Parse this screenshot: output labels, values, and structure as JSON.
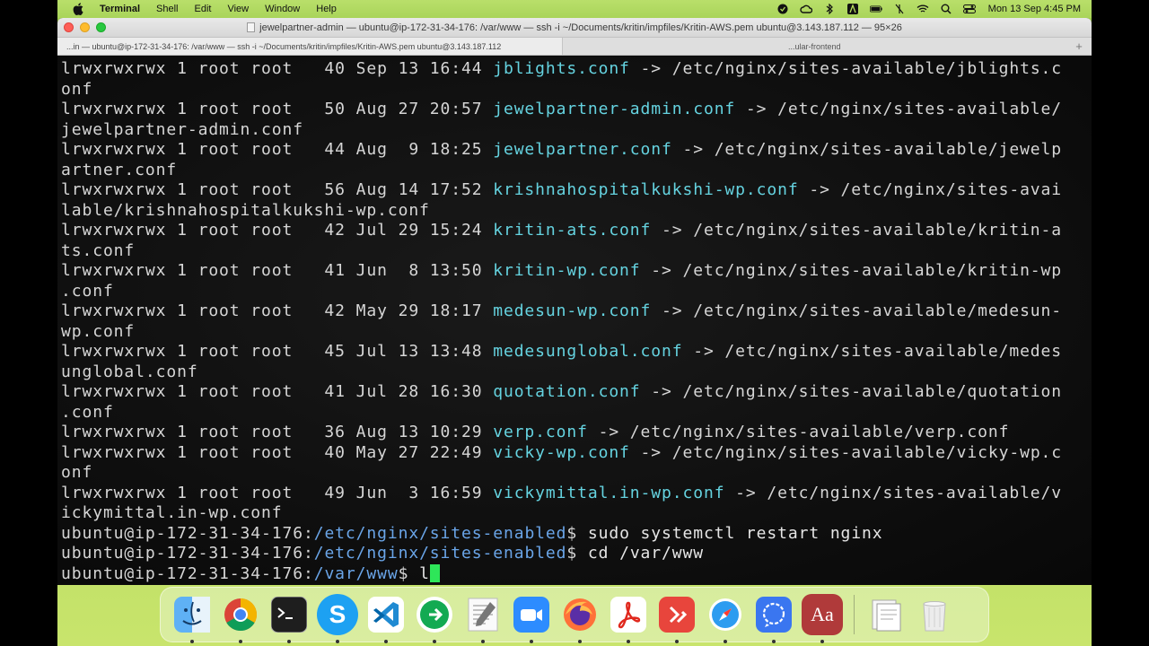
{
  "menubar": {
    "app_name": "Terminal",
    "items": [
      "Shell",
      "Edit",
      "View",
      "Window",
      "Help"
    ],
    "clock": "Mon 13 Sep  4:45 PM",
    "status_icons": [
      "vpn-icon",
      "creative-cloud-icon",
      "bluetooth-icon",
      "adobe-icon",
      "battery-icon",
      "extra-icon",
      "wifi-icon",
      "spotlight-search-icon",
      "control-center-icon"
    ]
  },
  "window": {
    "title": "jewelpartner-admin — ubuntu@ip-172-31-34-176: /var/www — ssh -i ~/Documents/kritin/impfiles/Kritin-AWS.pem ubuntu@3.143.187.112 — 95×26",
    "tabs": [
      {
        "label": "...in — ubuntu@ip-172-31-34-176: /var/www — ssh -i ~/Documents/kritin/impfiles/Kritin-AWS.pem ubuntu@3.143.187.112"
      },
      {
        "label": "...ular-frontend"
      }
    ],
    "add_tab": "+"
  },
  "terminal": {
    "lines": [
      {
        "type": "entry",
        "perm": "lrwxrwxrwx 1 root root   40 Sep 13 16:44 ",
        "link": "jblights.conf",
        "rest": " -> /etc/nginx/sites-available/jblights.c"
      },
      {
        "type": "plain",
        "text": "onf"
      },
      {
        "type": "entry",
        "perm": "lrwxrwxrwx 1 root root   50 Aug 27 20:57 ",
        "link": "jewelpartner-admin.conf",
        "rest": " -> /etc/nginx/sites-available/"
      },
      {
        "type": "plain",
        "text": "jewelpartner-admin.conf"
      },
      {
        "type": "entry",
        "perm": "lrwxrwxrwx 1 root root   44 Aug  9 18:25 ",
        "link": "jewelpartner.conf",
        "rest": " -> /etc/nginx/sites-available/jewelp"
      },
      {
        "type": "plain",
        "text": "artner.conf"
      },
      {
        "type": "entry",
        "perm": "lrwxrwxrwx 1 root root   56 Aug 14 17:52 ",
        "link": "krishnahospitalkukshi-wp.conf",
        "rest": " -> /etc/nginx/sites-avai"
      },
      {
        "type": "plain",
        "text": "lable/krishnahospitalkukshi-wp.conf"
      },
      {
        "type": "entry",
        "perm": "lrwxrwxrwx 1 root root   42 Jul 29 15:24 ",
        "link": "kritin-ats.conf",
        "rest": " -> /etc/nginx/sites-available/kritin-a"
      },
      {
        "type": "plain",
        "text": "ts.conf"
      },
      {
        "type": "entry",
        "perm": "lrwxrwxrwx 1 root root   41 Jun  8 13:50 ",
        "link": "kritin-wp.conf",
        "rest": " -> /etc/nginx/sites-available/kritin-wp"
      },
      {
        "type": "plain",
        "text": ".conf"
      },
      {
        "type": "entry",
        "perm": "lrwxrwxrwx 1 root root   42 May 29 18:17 ",
        "link": "medesun-wp.conf",
        "rest": " -> /etc/nginx/sites-available/medesun-"
      },
      {
        "type": "plain",
        "text": "wp.conf"
      },
      {
        "type": "entry",
        "perm": "lrwxrwxrwx 1 root root   45 Jul 13 13:48 ",
        "link": "medesunglobal.conf",
        "rest": " -> /etc/nginx/sites-available/medes"
      },
      {
        "type": "plain",
        "text": "unglobal.conf"
      },
      {
        "type": "entry",
        "perm": "lrwxrwxrwx 1 root root   41 Jul 28 16:30 ",
        "link": "quotation.conf",
        "rest": " -> /etc/nginx/sites-available/quotation"
      },
      {
        "type": "plain",
        "text": ".conf"
      },
      {
        "type": "entry",
        "perm": "lrwxrwxrwx 1 root root   36 Aug 13 10:29 ",
        "link": "verp.conf",
        "rest": " -> /etc/nginx/sites-available/verp.conf"
      },
      {
        "type": "entry",
        "perm": "lrwxrwxrwx 1 root root   40 May 27 22:49 ",
        "link": "vicky-wp.conf",
        "rest": " -> /etc/nginx/sites-available/vicky-wp.c"
      },
      {
        "type": "plain",
        "text": "onf"
      },
      {
        "type": "entry",
        "perm": "lrwxrwxrwx 1 root root   49 Jun  3 16:59 ",
        "link": "vickymittal.in-wp.conf",
        "rest": " -> /etc/nginx/sites-available/v"
      },
      {
        "type": "plain",
        "text": "ickymittal.in-wp.conf"
      },
      {
        "type": "prompt",
        "user": "ubuntu@ip-172-31-34-176",
        "sep": ":",
        "path": "/etc/nginx/sites-enabled",
        "sym": "$ ",
        "cmd": "sudo systemctl restart nginx"
      },
      {
        "type": "prompt",
        "user": "ubuntu@ip-172-31-34-176",
        "sep": ":",
        "path": "/etc/nginx/sites-enabled",
        "sym": "$ ",
        "cmd": "cd /var/www"
      },
      {
        "type": "prompt",
        "user": "ubuntu@ip-172-31-34-176",
        "sep": ":",
        "path": "/var/www",
        "sym": "$ ",
        "cmd": "l",
        "cursor": true
      }
    ],
    "colors": {
      "text": "#d6d6d6",
      "link": "#65d3e0",
      "path": "#6aa5e8",
      "cursor": "#2ee659"
    }
  },
  "dock": {
    "items": [
      {
        "name": "finder",
        "icon": "finder-icon",
        "color": "#4aa3f0",
        "running": true
      },
      {
        "name": "chrome",
        "icon": "chrome-icon",
        "color": "#ffffff",
        "running": true
      },
      {
        "name": "terminal",
        "icon": "terminal-icon",
        "color": "#1e1e1e",
        "running": true
      },
      {
        "name": "skype",
        "icon": "skype-icon",
        "color": "#1da1f2",
        "running": true
      },
      {
        "name": "vscode",
        "icon": "vscode-icon",
        "color": "#ffffff",
        "running": true
      },
      {
        "name": "mongodb-compass",
        "icon": "compass-icon",
        "color": "#ffffff",
        "running": true
      },
      {
        "name": "textedit",
        "icon": "textedit-icon",
        "color": "#f4f4f4",
        "running": true
      },
      {
        "name": "zoom",
        "icon": "zoom-icon",
        "color": "#2d8cff",
        "running": true
      },
      {
        "name": "firefox",
        "icon": "firefox-icon",
        "color": "#ff7139",
        "running": true
      },
      {
        "name": "acrobat",
        "icon": "acrobat-icon",
        "color": "#ffffff",
        "running": true
      },
      {
        "name": "remote-desktop",
        "icon": "remote-desktop-icon",
        "color": "#e8453c",
        "running": true
      },
      {
        "name": "safari",
        "icon": "safari-icon",
        "color": "#ffffff",
        "running": true
      },
      {
        "name": "signal",
        "icon": "signal-icon",
        "color": "#3a76f0",
        "running": true
      },
      {
        "name": "dictionary",
        "icon": "dictionary-icon",
        "color": "#b03a3a",
        "running": true
      },
      {
        "name": "documents-stack",
        "icon": "stack-icon",
        "color": "#ffffff",
        "running": false
      },
      {
        "name": "trash",
        "icon": "trash-icon",
        "color": "#e6e6e6",
        "running": false
      }
    ],
    "dictionary_label": "Aa",
    "skype_label": "S"
  }
}
